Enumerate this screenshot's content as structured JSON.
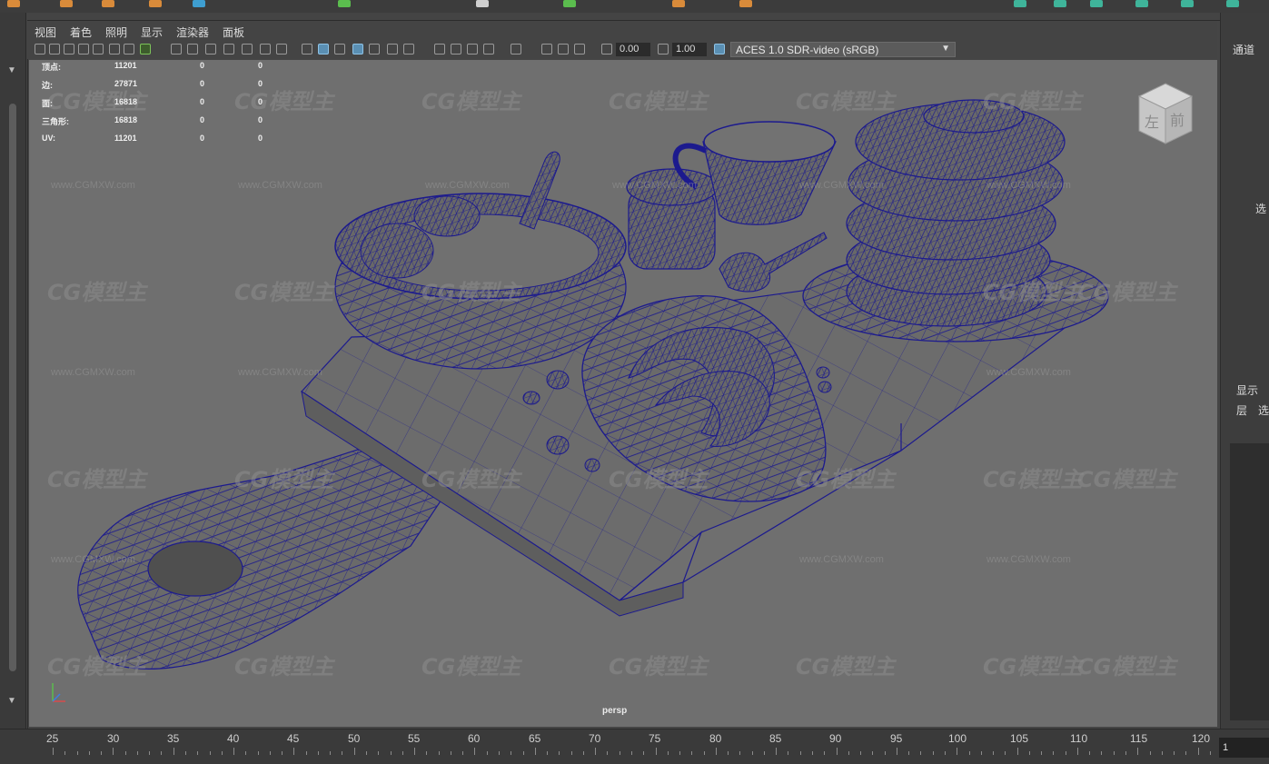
{
  "menu": {
    "items": [
      "视图",
      "着色",
      "照明",
      "显示",
      "渲染器",
      "面板"
    ]
  },
  "toolbar": {
    "exposure_value": "0.00",
    "gamma_value": "1.00",
    "color_space": "ACES 1.0 SDR-video (sRGB)"
  },
  "hud": {
    "rows": [
      {
        "label": "顶点:",
        "v1": "11201",
        "v2": "0",
        "v3": "0"
      },
      {
        "label": "边:",
        "v1": "27871",
        "v2": "0",
        "v3": "0"
      },
      {
        "label": "面:",
        "v1": "16818",
        "v2": "0",
        "v3": "0"
      },
      {
        "label": "三角形:",
        "v1": "16818",
        "v2": "0",
        "v3": "0"
      },
      {
        "label": "UV:",
        "v1": "11201",
        "v2": "0",
        "v3": "0"
      }
    ]
  },
  "viewport": {
    "camera": "persp",
    "watermark_logo": "CG模型主",
    "watermark_url": "www.CGMXW.com",
    "viewcube": {
      "left_face": "左",
      "front_face": "前"
    }
  },
  "right_panel": {
    "channel_tab": "通道",
    "select_fragment": "选",
    "display_tab": "显示",
    "layer_label": "层",
    "select_label": "选"
  },
  "timeline": {
    "ticks": [
      "25",
      "30",
      "35",
      "40",
      "45",
      "50",
      "55",
      "60",
      "65",
      "70",
      "75",
      "80",
      "85",
      "90",
      "95",
      "100",
      "105",
      "110",
      "115",
      "120"
    ],
    "current_frame": "1"
  },
  "colors": {
    "wireframe": "#1c1a8e",
    "viewport_bg": "#6f6f6f",
    "mesh_fill": "#6a6a6a"
  }
}
